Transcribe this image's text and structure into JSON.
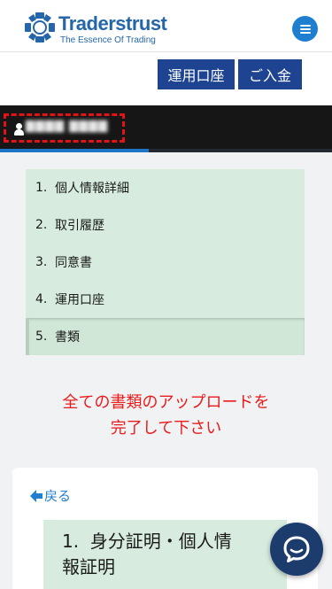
{
  "brand": {
    "name": "Traderstrust",
    "tagline": "The Essence Of Trading",
    "color": "#2466a9"
  },
  "header": {
    "menu_icon": "hamburger-icon"
  },
  "actions": {
    "operate_account": "運用口座",
    "deposit": "ご入金",
    "button_color": "#1d4391"
  },
  "user": {
    "name_redacted": "▇▇▇▇ ▇▇▇▇",
    "icon": "user-icon"
  },
  "steps": [
    {
      "num": "1.",
      "label": "個人情報詳細"
    },
    {
      "num": "2.",
      "label": "取引履歴"
    },
    {
      "num": "3.",
      "label": "同意書"
    },
    {
      "num": "4.",
      "label": "運用口座"
    },
    {
      "num": "5.",
      "label": "書類",
      "active": true
    }
  ],
  "notice": {
    "line1": "全ての書類のアップロードを",
    "line2": "完了して下さい",
    "color": "#ea1b1b"
  },
  "card": {
    "back_label": "戻る",
    "back_icon": "arrow-left-icon",
    "doc_title_line1": "1.  身分証明・個人情",
    "doc_title_line2": "報証明"
  },
  "chat": {
    "icon": "chat-bubble-icon"
  }
}
